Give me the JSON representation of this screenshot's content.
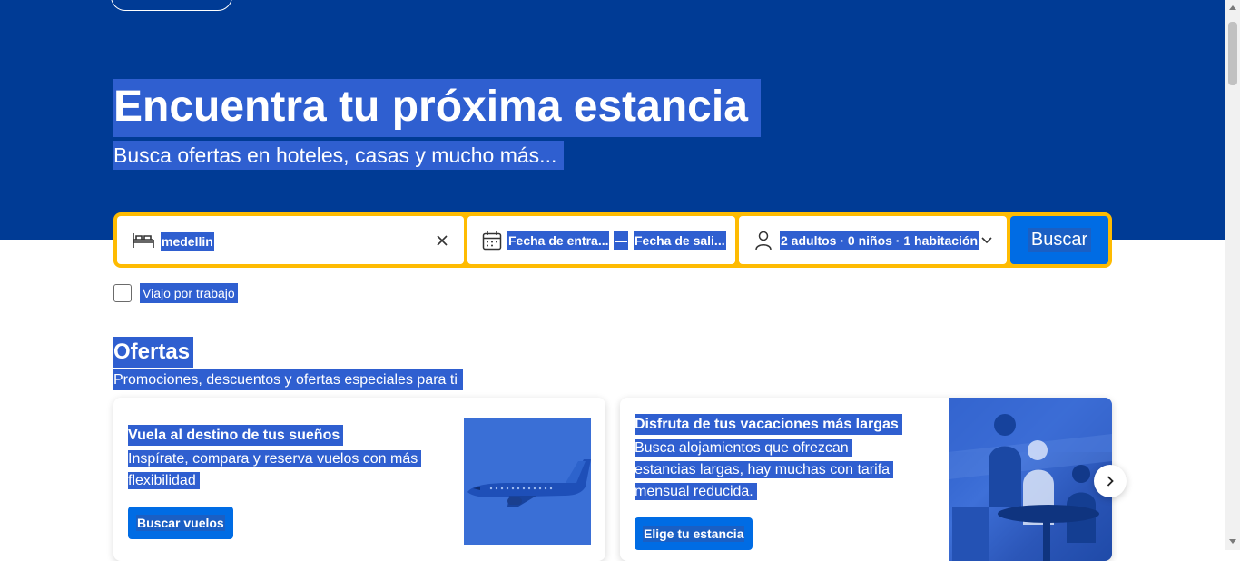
{
  "hero": {
    "title": "Encuentra tu próxima estancia",
    "subtitle": "Busca ofertas en hoteles, casas y mucho más..."
  },
  "search": {
    "destination_value": "medellin",
    "checkin_placeholder": "Fecha de entra...",
    "date_separator": "—",
    "checkout_placeholder": "Fecha de sali...",
    "occupancy": "2 adultos · 0 niños · 1 habitación",
    "submit_label": "Buscar"
  },
  "business_trip": {
    "label": "Viajo por trabajo",
    "checked": false
  },
  "offers": {
    "title": "Ofertas",
    "subtitle": "Promociones, descuentos y ofertas especiales para ti",
    "cards": [
      {
        "title": "Vuela al destino de tus sueños",
        "text_line1": "Inspírate, compara y reserva vuelos con más",
        "text_line2": "flexibilidad",
        "button": "Buscar vuelos",
        "image_icon": "airplane-image"
      },
      {
        "title": "Disfruta de tus vacaciones más largas",
        "text_line1": "Busca alojamientos que ofrezcan",
        "text_line2": "estancias largas, hay muchas con tarifa",
        "text_line3": "mensual reducida.",
        "button": "Elige tu estancia",
        "image_icon": "people-photo"
      }
    ]
  },
  "colors": {
    "brand_blue": "#003b95",
    "accent_yellow": "#febb02",
    "button_blue": "#006ce4",
    "selection": "#2f5fd0"
  }
}
